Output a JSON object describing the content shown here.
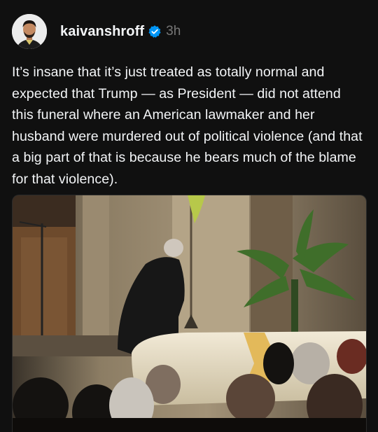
{
  "post": {
    "author": {
      "username": "kaivanshroff",
      "verified": true,
      "avatar_icon": "profile-avatar"
    },
    "timestamp": "3h",
    "text": "It’s insane that it’s just treated as totally normal and expected that Trump — as President — did not attend this funeral where an American lawmaker and her husband were murdered out of political violence (and that a big part of that is because he bears much of the blame for that violence).",
    "media": {
      "type": "photo",
      "icon": "attached-photo"
    }
  },
  "colors": {
    "background": "#101010",
    "text": "#f3f5f7",
    "muted": "#777777",
    "verified_badge": "#0095f6"
  }
}
